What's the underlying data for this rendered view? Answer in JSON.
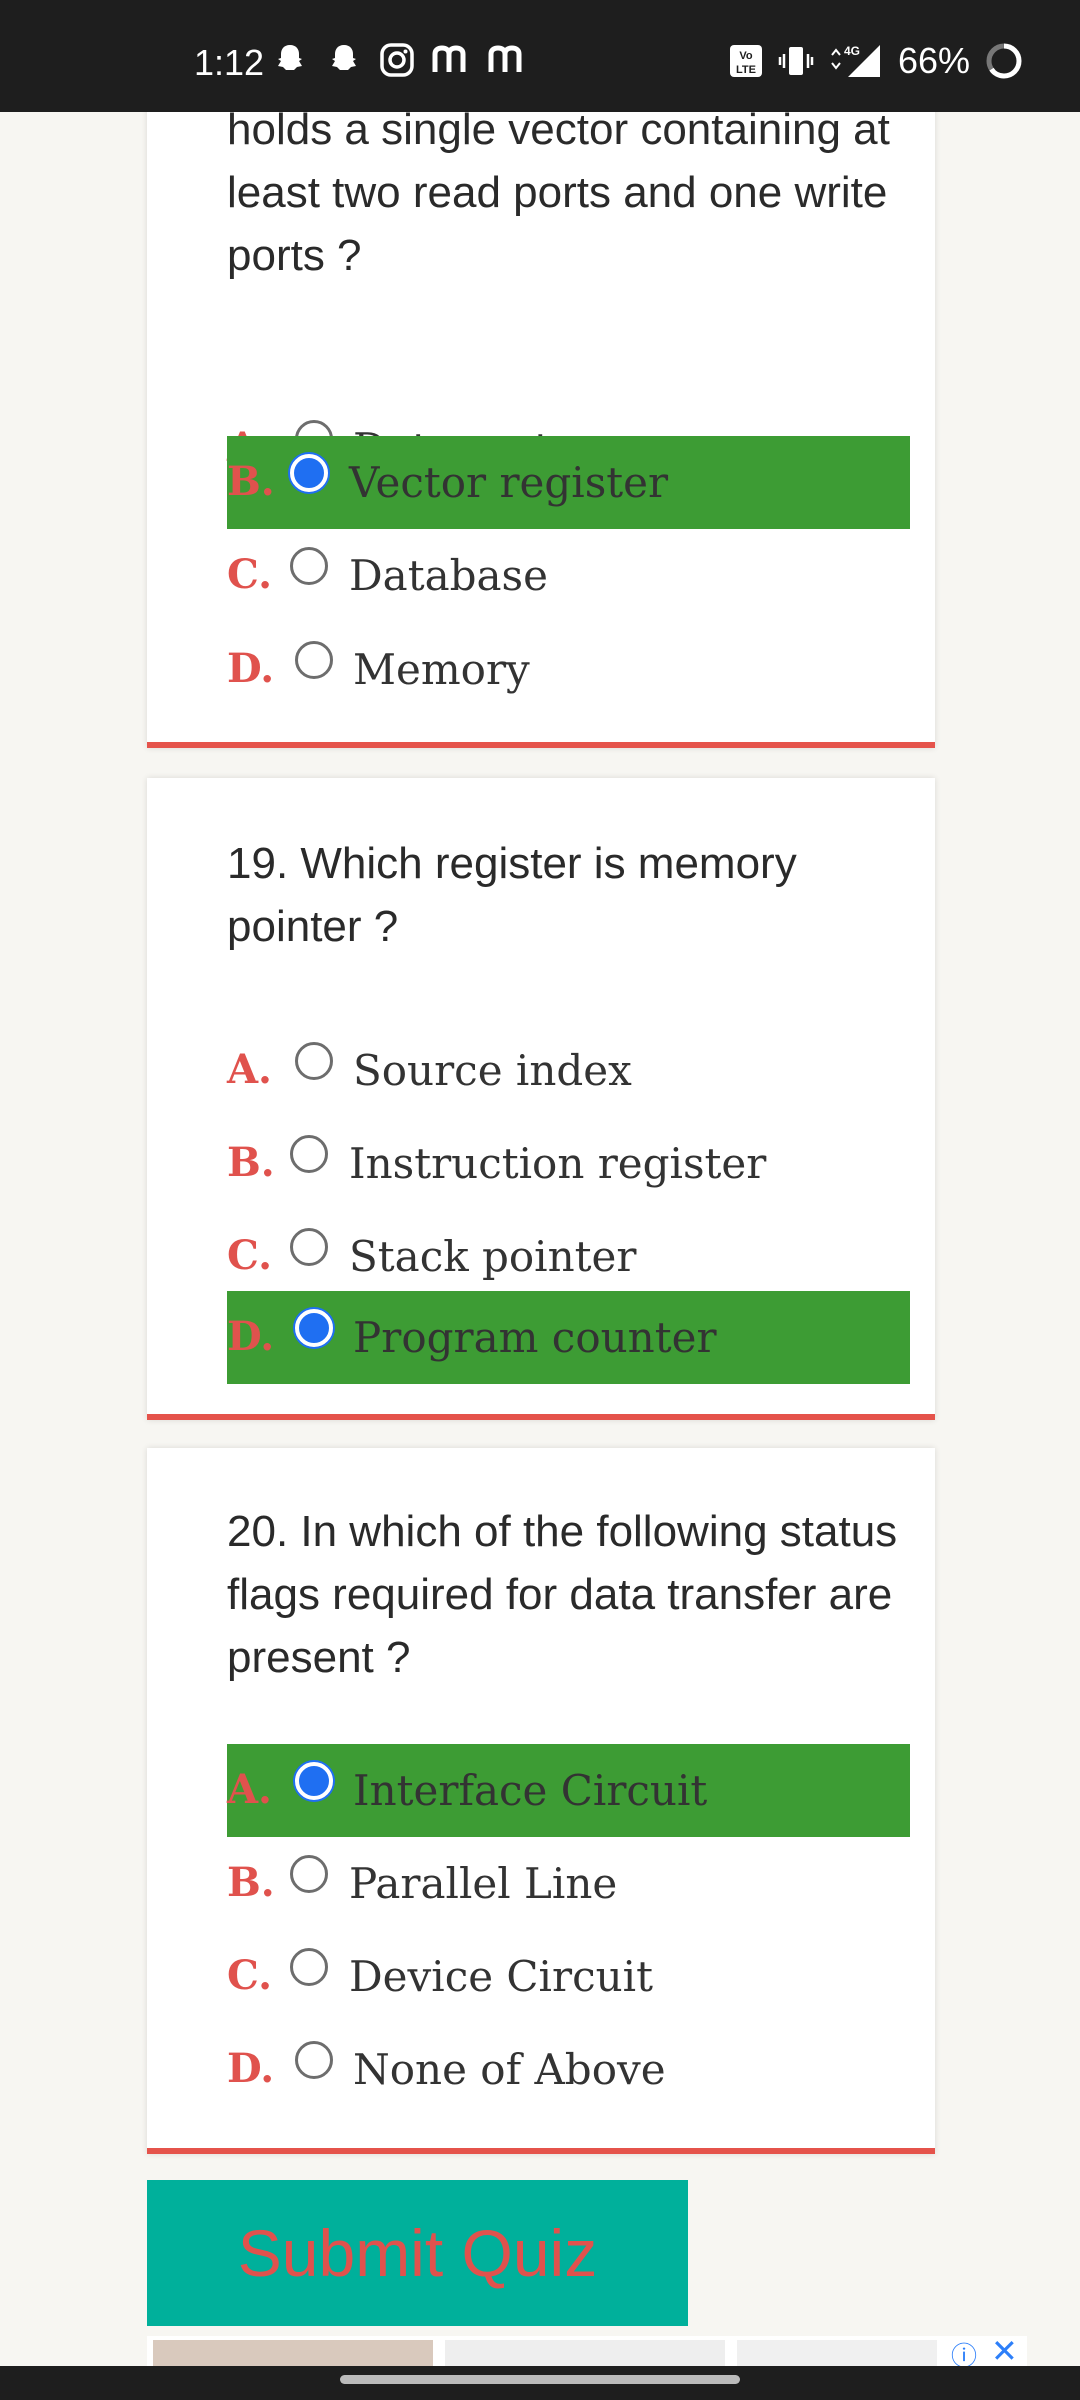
{
  "status_bar": {
    "time": "1:12",
    "battery": "66%",
    "left_icons": [
      "snapchat-icon",
      "snapchat-icon",
      "instagram-icon",
      "m-icon",
      "m-icon"
    ],
    "right_icons": [
      "volte-icon",
      "vibrate-icon",
      "4g-signal-icon",
      "battery-ring-icon"
    ]
  },
  "quiz": {
    "questions": [
      {
        "text": "holds a single vector containing at least two read ports and one write ports ?",
        "options": [
          {
            "letter": "A.",
            "label": "Data system",
            "selected": false
          },
          {
            "letter": "B.",
            "label": "Vector register",
            "selected": true
          },
          {
            "letter": "C.",
            "label": "Database",
            "selected": false
          },
          {
            "letter": "D.",
            "label": "Memory",
            "selected": false
          }
        ]
      },
      {
        "text": "19. Which register is memory pointer ?",
        "options": [
          {
            "letter": "A.",
            "label": "Source index",
            "selected": false
          },
          {
            "letter": "B.",
            "label": "Instruction register",
            "selected": false
          },
          {
            "letter": "C.",
            "label": "Stack pointer",
            "selected": false
          },
          {
            "letter": "D.",
            "label": "Program counter",
            "selected": true
          }
        ]
      },
      {
        "text": "20. In which of the following status flags required for data transfer are present ?",
        "options": [
          {
            "letter": "A.",
            "label": "Interface Circuit",
            "selected": true
          },
          {
            "letter": "B.",
            "label": "Parallel Line",
            "selected": false
          },
          {
            "letter": "C.",
            "label": "Device Circuit",
            "selected": false
          },
          {
            "letter": "D.",
            "label": "None of Above",
            "selected": false
          }
        ]
      }
    ],
    "submit_label": "Submit Quiz"
  },
  "colors": {
    "selected_option_bg": "#3d9c34",
    "letter": "#e0524d",
    "submit_bg": "#00b09b",
    "card_border": "#e5534b"
  }
}
